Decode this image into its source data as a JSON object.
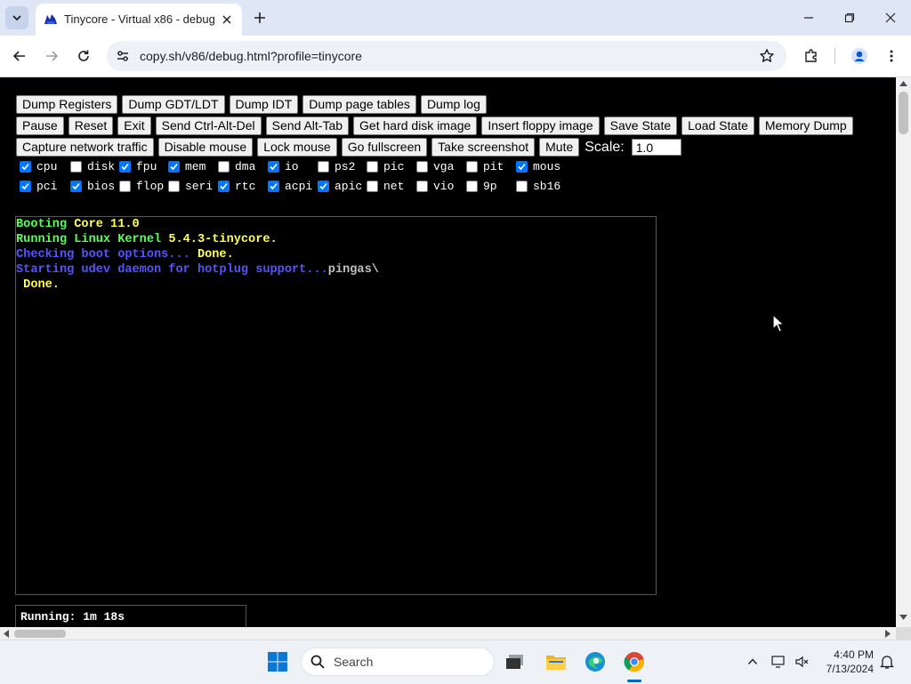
{
  "browser": {
    "tab_title": "Tinycore - Virtual x86 - debug",
    "url": "copy.sh/v86/debug.html?profile=tinycore"
  },
  "buttons": {
    "row1": [
      "Dump Registers",
      "Dump GDT/LDT",
      "Dump IDT",
      "Dump page tables",
      "Dump log"
    ],
    "row2": [
      "Pause",
      "Reset",
      "Exit",
      "Send Ctrl-Alt-Del",
      "Send Alt-Tab",
      "Get hard disk image",
      "Insert floppy image",
      "Save State",
      "Load State",
      "Memory Dump"
    ],
    "row3": [
      "Capture network traffic",
      "Disable mouse",
      "Lock mouse",
      "Go fullscreen",
      "Take screenshot",
      "Mute"
    ]
  },
  "scale": {
    "label": "Scale:",
    "value": "1.0"
  },
  "log_filters": {
    "row1": [
      {
        "label": "cpu",
        "checked": true
      },
      {
        "label": "disk",
        "checked": false
      },
      {
        "label": "fpu",
        "checked": true
      },
      {
        "label": "mem",
        "checked": true
      },
      {
        "label": "dma",
        "checked": false
      },
      {
        "label": "io",
        "checked": true
      },
      {
        "label": "ps2",
        "checked": false
      },
      {
        "label": "pic",
        "checked": false
      },
      {
        "label": "vga",
        "checked": false
      },
      {
        "label": "pit",
        "checked": false
      },
      {
        "label": "mous",
        "checked": true
      }
    ],
    "row2": [
      {
        "label": "pci",
        "checked": true
      },
      {
        "label": "bios",
        "checked": true
      },
      {
        "label": "flop",
        "checked": false
      },
      {
        "label": "seri",
        "checked": false
      },
      {
        "label": "rtc",
        "checked": true
      },
      {
        "label": "acpi",
        "checked": true
      },
      {
        "label": "apic",
        "checked": true
      },
      {
        "label": "net",
        "checked": false
      },
      {
        "label": "vio",
        "checked": false
      },
      {
        "label": "9p",
        "checked": false
      },
      {
        "label": "sb16",
        "checked": false
      }
    ]
  },
  "terminal": {
    "line1_a": "Booting ",
    "line1_b": "Core 11.0",
    "line2_a": "Running Linux Kernel ",
    "line2_b": "5.4.3-tinycore.",
    "line3_a": "Checking boot options... ",
    "line3_b": "Done.",
    "line4_a": "Starting udev daemon for hotplug support...",
    "line4_b": "pingas\\",
    "line5": " Done."
  },
  "status": "Running: 1m 18s",
  "taskbar": {
    "search_placeholder": "Search",
    "time": "4:40 PM",
    "date": "7/13/2024"
  },
  "colors": {
    "terminal_green": "#55ff55",
    "terminal_yellow": "#ffff55",
    "terminal_blue": "#5555ff",
    "checkbox_accent": "#0075ff"
  }
}
